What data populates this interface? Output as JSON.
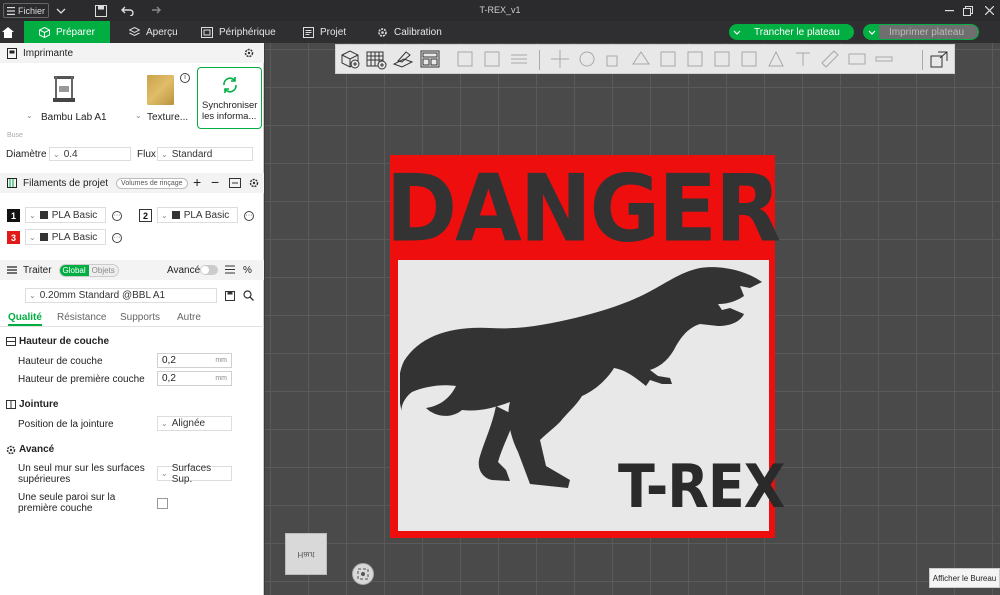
{
  "window": {
    "title": "T-REX_v1",
    "file_menu": "Fichier"
  },
  "nav": {
    "tabs": [
      {
        "label": "Préparer",
        "active": true
      },
      {
        "label": "Aperçu"
      },
      {
        "label": "Périphérique"
      },
      {
        "label": "Projet"
      },
      {
        "label": "Calibration"
      }
    ],
    "slice_label": "Trancher le plateau",
    "print_label": "Imprimer plateau"
  },
  "printer": {
    "header": "Imprimante",
    "printer_name": "Bambu Lab A1",
    "plate_name": "Texture...",
    "sync_label_1": "Synchroniser",
    "sync_label_2": "les informa...",
    "nozzle_section": "Buse",
    "diameter_label": "Diamètre",
    "diameter_value": "0.4",
    "flow_label": "Flux",
    "flow_value": "Standard"
  },
  "filaments": {
    "header": "Filaments de projet",
    "purge_label": "Volumes de rinçage",
    "items": [
      {
        "num": "1",
        "color": "#111111",
        "name": "PLA Basic"
      },
      {
        "num": "2",
        "color": "#ffffff",
        "name": "PLA Basic"
      },
      {
        "num": "3",
        "color": "#e01919",
        "name": "PLA Basic"
      }
    ]
  },
  "process": {
    "header": "Traiter",
    "toggle_global": "Global",
    "toggle_objects": "Objets",
    "advanced_label": "Avancé",
    "preset": "0.20mm Standard @BBL A1",
    "tabs": [
      "Qualité",
      "Résistance",
      "Supports",
      "Autre"
    ]
  },
  "quality": {
    "layer_height_group": "Hauteur de couche",
    "layer_height_label": "Hauteur de couche",
    "layer_height_value": "0,2",
    "first_layer_label": "Hauteur de première couche",
    "first_layer_value": "0,2",
    "unit": "mm",
    "seam_group": "Jointure",
    "seam_label": "Position de la jointure",
    "seam_value": "Alignée",
    "advanced_group": "Avancé",
    "single_wall_top_1": "Un seul mur sur les surfaces",
    "single_wall_top_2": "supérieures",
    "single_wall_top_value": "Surfaces Sup.",
    "single_wall_first_1": "Une seule paroi sur la",
    "single_wall_first_2": "première couche"
  },
  "viewport": {
    "sign_top": "DANGER",
    "sign_bottom": "T-REX",
    "view_cube_label": "Haut",
    "desktop_tip": "Afficher le Bureau"
  },
  "colors": {
    "accent": "#00ae42",
    "sign_red": "#ee0e0e",
    "sign_text": "#333333"
  }
}
